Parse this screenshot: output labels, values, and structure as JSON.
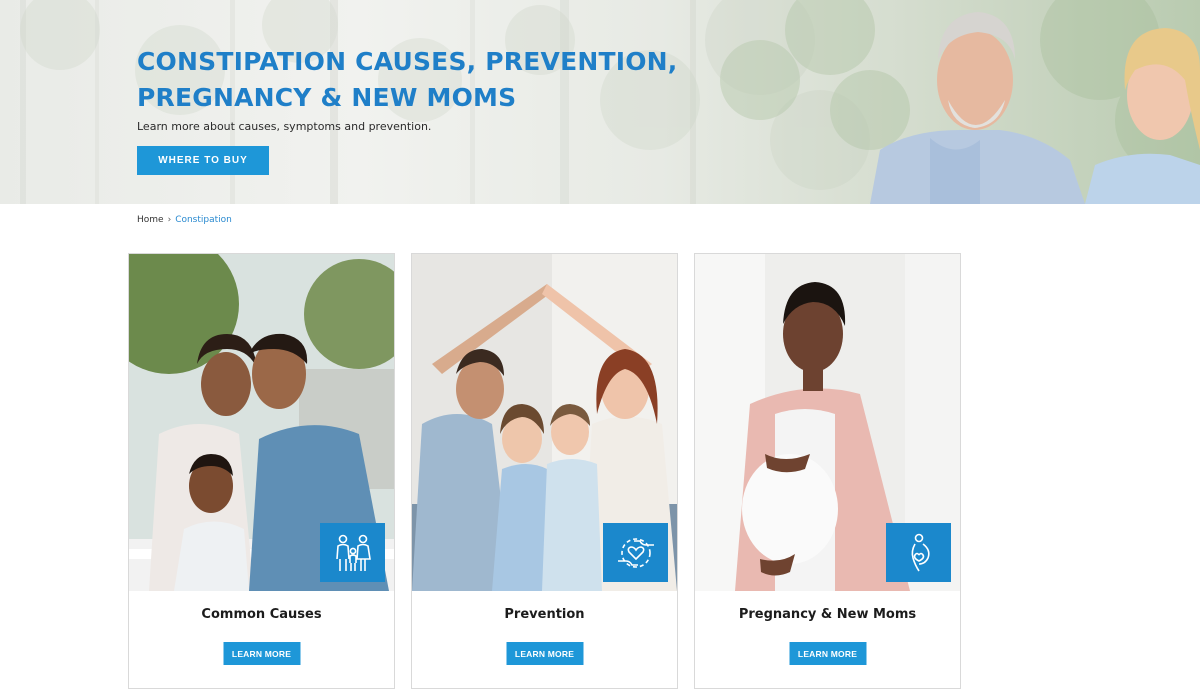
{
  "hero": {
    "title": "CONSTIPATION CAUSES, PREVENTION, PREGNANCY & NEW MOMS",
    "subtitle": "Learn more about causes, symptoms and prevention.",
    "cta_label": "WHERE TO BUY"
  },
  "breadcrumb": {
    "home": "Home",
    "separator": "›",
    "current": "Constipation"
  },
  "cards": [
    {
      "title": "Common Causes",
      "button": "LEARN MORE",
      "icon": "family-icon"
    },
    {
      "title": "Prevention",
      "button": "LEARN MORE",
      "icon": "hands-heart-icon"
    },
    {
      "title": "Pregnancy & New Moms",
      "button": "LEARN MORE",
      "icon": "pregnancy-icon"
    }
  ],
  "colors": {
    "brand_blue": "#1f7fc8",
    "button_blue": "#1e97d8",
    "badge_blue": "#1b88cc"
  }
}
